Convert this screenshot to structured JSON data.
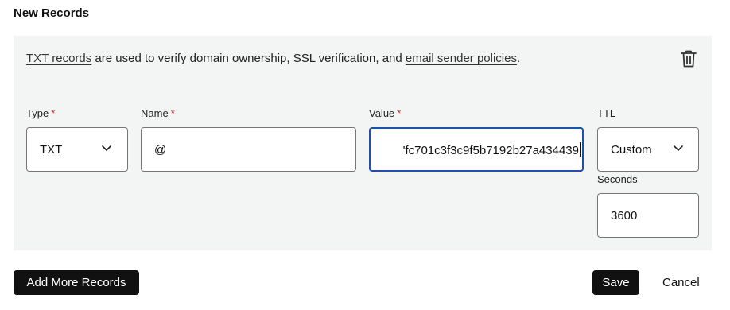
{
  "title": "New Records",
  "info": {
    "link1": "TXT records",
    "middle": " are used to verify domain ownership, SSL verification, and ",
    "link2": "email sender policies",
    "end": "."
  },
  "form": {
    "type": {
      "label": "Type",
      "required": "*",
      "value": "TXT"
    },
    "name": {
      "label": "Name",
      "required": "*",
      "value": "@"
    },
    "value": {
      "label": "Value",
      "required": "*",
      "value": "'fc701c3f3c9f5b7192b27a434439"
    },
    "ttl": {
      "label": "TTL",
      "value": "Custom"
    },
    "seconds": {
      "label": "Seconds",
      "value": "3600"
    }
  },
  "buttons": {
    "add_more": "Add More Records",
    "save": "Save",
    "cancel": "Cancel"
  },
  "icons": {
    "delete": "trash-icon",
    "dropdown": "chevron-down-icon"
  },
  "colors": {
    "panel": "#f3f5f5",
    "required": "#c4262e",
    "focus": "#1f4fa8",
    "button": "#111111"
  }
}
